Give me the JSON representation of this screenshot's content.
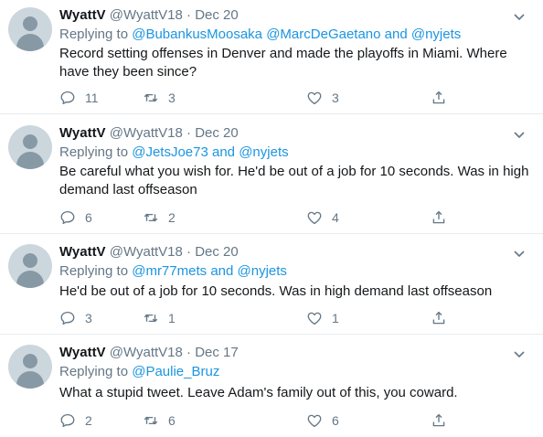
{
  "tweets": [
    {
      "name": "WyattV",
      "handle": "@WyattV18",
      "dot": "·",
      "date": "Dec 20",
      "replying_prefix": "Replying to",
      "replying_mentions": [
        "@BubankusMoosaka",
        "@MarcDeGaetano"
      ],
      "replying_and": "and",
      "replying_last": "@nyjets",
      "text": "Record setting offenses in Denver and made the playoffs in Miami. Where have they been since?",
      "replies": "11",
      "retweets": "3",
      "likes": "3"
    },
    {
      "name": "WyattV",
      "handle": "@WyattV18",
      "dot": "·",
      "date": "Dec 20",
      "replying_prefix": "Replying to",
      "replying_mentions": [
        "@JetsJoe73"
      ],
      "replying_and": "and",
      "replying_last": "@nyjets",
      "text": "Be careful what you wish for. He'd be out of a job for 10 seconds. Was in high demand last offseason",
      "replies": "6",
      "retweets": "2",
      "likes": "4"
    },
    {
      "name": "WyattV",
      "handle": "@WyattV18",
      "dot": "·",
      "date": "Dec 20",
      "replying_prefix": "Replying to",
      "replying_mentions": [
        "@mr77mets"
      ],
      "replying_and": "and",
      "replying_last": "@nyjets",
      "text": "He'd be out of a job for 10 seconds. Was in high demand last offseason",
      "replies": "3",
      "retweets": "1",
      "likes": "1"
    },
    {
      "name": "WyattV",
      "handle": "@WyattV18",
      "dot": "·",
      "date": "Dec 17",
      "replying_prefix": "Replying to",
      "replying_mentions": [],
      "replying_and": "",
      "replying_last": "@Paulie_Bruz",
      "text": "What a stupid tweet. Leave Adam's family out of this, you coward.",
      "replies": "2",
      "retweets": "6",
      "likes": "6"
    }
  ],
  "colors": {
    "text": "#14171a",
    "muted": "#657786",
    "link": "#1b95e0",
    "divider": "#e6ecf0",
    "avatar_bg": "#ccd6dd",
    "avatar_fg": "#8899a6"
  },
  "icons": {
    "reply": "reply-icon",
    "retweet": "retweet-icon",
    "like": "heart-icon",
    "share": "share-icon",
    "menu": "chevron-down-icon"
  }
}
